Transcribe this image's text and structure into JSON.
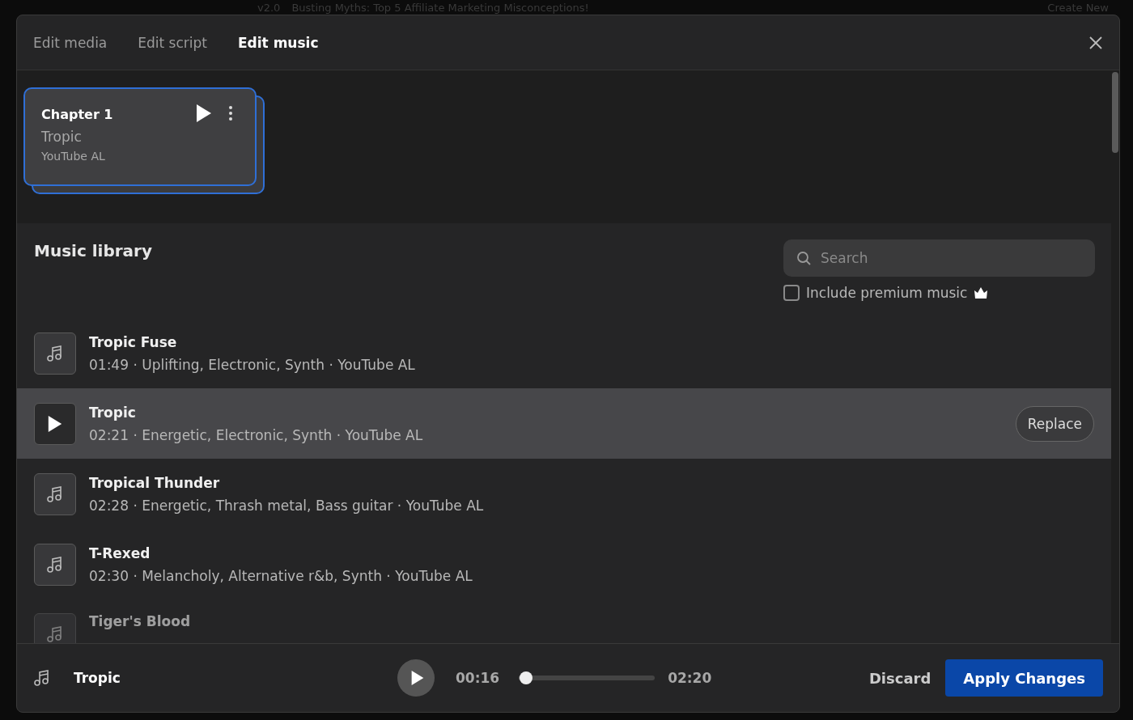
{
  "backdrop": {
    "version": "v2.0",
    "title": "Busting Myths: Top 5 Affiliate Marketing Misconceptions!",
    "create": "Create New"
  },
  "tabs": [
    {
      "label": "Edit media",
      "selected": false
    },
    {
      "label": "Edit script",
      "selected": false
    },
    {
      "label": "Edit music",
      "selected": true
    }
  ],
  "chapters": [
    {
      "title": "Chapter 1",
      "track": "Tropic",
      "source": "YouTube AL",
      "selected": true
    }
  ],
  "library": {
    "title": "Music library",
    "search": {
      "placeholder": "Search"
    },
    "premium": {
      "label": "Include premium music",
      "checked": false
    },
    "tracks": [
      {
        "title": "Tropic Fuse",
        "meta": "01:49 · Uplifting, Electronic, Synth · YouTube AL",
        "selected": false
      },
      {
        "title": "Tropic",
        "meta": "02:21 · Energetic, Electronic, Synth · YouTube AL",
        "selected": true,
        "action": "Replace"
      },
      {
        "title": "Tropical Thunder",
        "meta": "02:28 · Energetic, Thrash metal, Bass guitar · YouTube AL",
        "selected": false
      },
      {
        "title": "T-Rexed",
        "meta": "02:30 · Melancholy, Alternative r&b, Synth · YouTube AL",
        "selected": false
      },
      {
        "title": "Tiger's Blood",
        "selected": false
      }
    ]
  },
  "player": {
    "track": "Tropic",
    "elapsed": "00:16",
    "total": "02:20",
    "level": 0.05
  },
  "buttons": {
    "discard": "Discard",
    "apply": "Apply Changes"
  }
}
